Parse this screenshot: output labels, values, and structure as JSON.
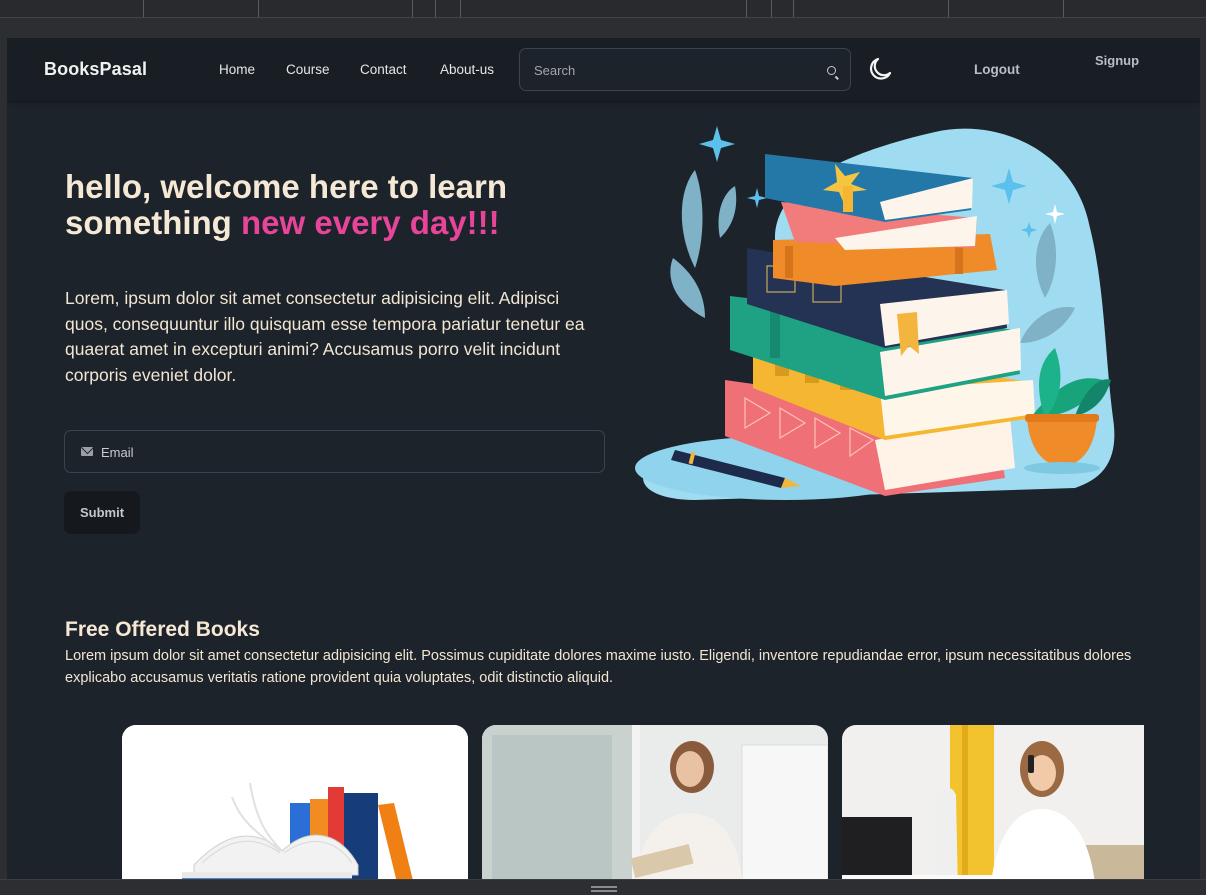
{
  "navbar": {
    "brand": "BooksPasal",
    "links": [
      "Home",
      "Course",
      "Contact",
      "About-us"
    ],
    "search_placeholder": "Search",
    "logout_label": "Logout",
    "signup_label": "Signup"
  },
  "hero": {
    "title_part1": "hello, welcome here to learn",
    "title_part2": "something",
    "title_highlight": "new every day!!!",
    "paragraph": "Lorem, ipsum dolor sit amet consectetur adipisicing elit. Adipisci quos, consequuntur illo quisquam esse tempora pariatur tenetur ea quaerat amet in excepturi animi? Accusamus porro velit incidunt corporis eveniet dolor.",
    "email_placeholder": "Email",
    "submit_label": "Submit"
  },
  "free_books": {
    "title": "Free Offered Books",
    "description": "Lorem ipsum dolor sit amet consectetur adipisicing elit. Possimus cupiditate dolores maxime iusto. Eligendi, inventore repudiandae error, ipsum necessitatibus dolores explicabo accusamus veritatis ratione provident quia voluptates, odit distinctio aliquid."
  },
  "colors": {
    "background": "#1d232a",
    "navbar": "#191e24",
    "heading_text": "#f5e9d6",
    "accent_pink": "#e8449a"
  },
  "icons": [
    "search-icon",
    "moon-icon",
    "email-icon"
  ]
}
